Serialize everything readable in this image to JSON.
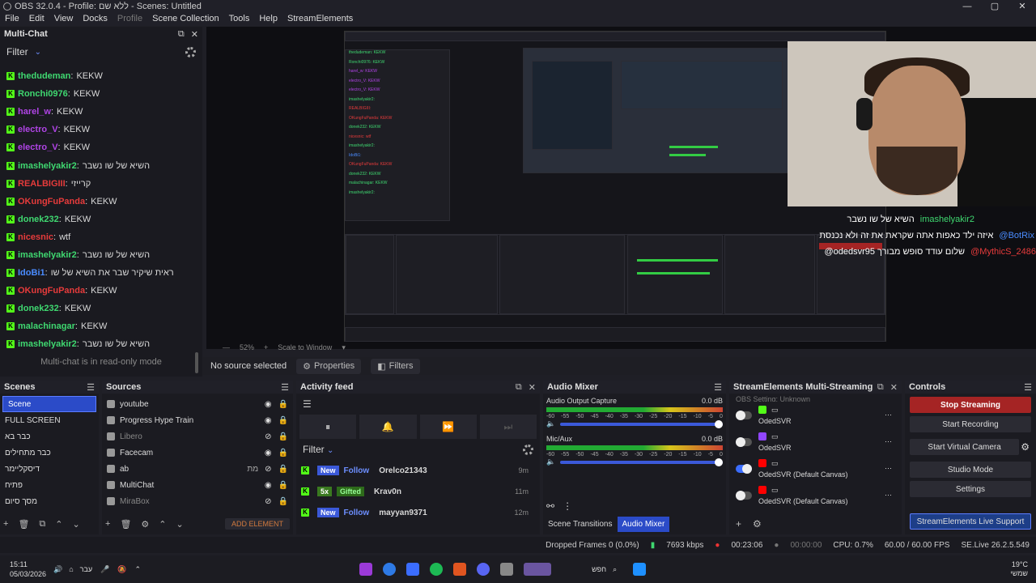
{
  "window": {
    "title": "OBS 32.0.4 - Profile: ללא שם - Scenes: Untitled"
  },
  "window_controls": {
    "minimize": "—",
    "maximize": "▢",
    "close": "✕"
  },
  "menu": [
    "File",
    "Edit",
    "View",
    "Docks",
    "Profile",
    "Scene Collection",
    "Tools",
    "Help",
    "StreamElements"
  ],
  "multichat": {
    "title": "Multi-Chat",
    "filter_label": "Filter",
    "readonly_note": "Multi-chat is in read-only mode",
    "messages": [
      {
        "user": "thedudeman",
        "color": "#3fd870",
        "text": "KEKW"
      },
      {
        "user": "Ronchi0976",
        "color": "#3fd870",
        "text": "KEKW"
      },
      {
        "user": "harel_w",
        "color": "#b044e6",
        "text": "KEKW"
      },
      {
        "user": "electro_V",
        "color": "#b044e6",
        "text": "KEKW"
      },
      {
        "user": "electro_V",
        "color": "#b044e6",
        "text": "KEKW"
      },
      {
        "user": "imashelyakir2",
        "color": "#3fd870",
        "text": "השיא של שו נשבר"
      },
      {
        "user": "REALBIGIII",
        "color": "#e63b3b",
        "text": "קרייזי"
      },
      {
        "user": "OKungFuPanda",
        "color": "#e63b3b",
        "text": "KEKW"
      },
      {
        "user": "donek232",
        "color": "#3fd870",
        "text": "KEKW"
      },
      {
        "user": "nicesnic",
        "color": "#e63b3b",
        "text": "wtf"
      },
      {
        "user": "imashelyakir2",
        "color": "#3fd870",
        "text": "השיא של שו נשבר"
      },
      {
        "user": "IdoBi1",
        "color": "#4a8cff",
        "text": "ראית שיקיר שבר את השיא של שו"
      },
      {
        "user": "OKungFuPanda",
        "color": "#e63b3b",
        "text": "KEKW"
      },
      {
        "user": "donek232",
        "color": "#3fd870",
        "text": "KEKW"
      },
      {
        "user": "malachinagar",
        "color": "#3fd870",
        "text": "KEKW"
      },
      {
        "user": "imashelyakir2",
        "color": "#3fd870",
        "text": "השיא של שו נשבר"
      }
    ]
  },
  "overlay_chat": [
    {
      "user": "imashelyakir2",
      "text": "השיא של שו נשבר"
    },
    {
      "user": "@BotRix",
      "text": "איזה ילד כאפות אתה שקראת את זה ולא נכנסת"
    },
    {
      "user": "@MythicS_2486",
      "text": "@odedsvr95 שלום עודד סופש מבורך"
    }
  ],
  "preview": {
    "zoom": "52%",
    "scale_label": "Scale to Window"
  },
  "context_bar": {
    "no_source": "No source selected",
    "properties": "Properties",
    "filters": "Filters"
  },
  "scenes": {
    "title": "Scenes",
    "items": [
      "Scene",
      "FULL SCREEN",
      "כבר בא",
      "כבר מתחילים",
      "דיסקליימר",
      "פתיח",
      "מסך סיום"
    ],
    "selected": 0
  },
  "sources": {
    "title": "Sources",
    "items": [
      "youtube",
      "Progress Hype Train",
      "Libero",
      "Facecam",
      "ab",
      "MultiChat",
      "MiraBox"
    ],
    "ab_suffix": "מת",
    "add_element": "ADD ELEMENT"
  },
  "activity": {
    "title": "Activity feed",
    "filter_label": "Filter",
    "items": [
      {
        "tag": "New",
        "type": "Follow",
        "user": "Orelco21343",
        "time": "9m"
      },
      {
        "tag": "5x",
        "type": "Gifted",
        "user": "Krav0n",
        "time": "11m"
      },
      {
        "tag": "New",
        "type": "Follow",
        "user": "mayyan9371",
        "time": "12m"
      }
    ]
  },
  "mixer": {
    "title": "Audio Mixer",
    "channels": [
      {
        "name": "Audio Output Capture",
        "db": "0.0 dB"
      },
      {
        "name": "Mic/Aux",
        "db": "0.0 dB"
      }
    ],
    "scale": [
      "-60",
      "-55",
      "-50",
      "-45",
      "-40",
      "-35",
      "-30",
      "-25",
      "-20",
      "-15",
      "-10",
      "-5",
      "0"
    ],
    "tabs": [
      "Scene Transitions",
      "Audio Mixer"
    ]
  },
  "multistream": {
    "title": "StreamElements Multi-Streaming",
    "header_row": "OBS Setting: Unknown",
    "items": [
      {
        "name": "OdedSVR",
        "on": false,
        "color": "#53fc18"
      },
      {
        "name": "OdedSVR",
        "on": false,
        "color": "#9146ff"
      },
      {
        "name": "OdedSVR (Default Canvas)",
        "on": true,
        "color": "#ff0000"
      },
      {
        "name": "OdedSVR (Default Canvas)",
        "on": false,
        "color": "#ff0000"
      }
    ]
  },
  "controls": {
    "title": "Controls",
    "buttons": [
      "Stop Streaming",
      "Start Recording",
      "Start Virtual Camera",
      "Studio Mode",
      "Settings"
    ],
    "support": "StreamElements Live Support"
  },
  "status": {
    "dropped": "Dropped Frames 0 (0.0%)",
    "kbps": "7693 kbps",
    "live_time": "00:23:06",
    "rec_time": "00:00:00",
    "cpu": "CPU: 0.7%",
    "fps": "60.00 / 60.00 FPS",
    "se": "SE.Live 26.2.5.549"
  },
  "taskbar": {
    "time": "15:11",
    "date": "05/03/2026",
    "lang": "עבר",
    "search": "חפש",
    "temp": "19°C",
    "weather": "שמשי"
  }
}
